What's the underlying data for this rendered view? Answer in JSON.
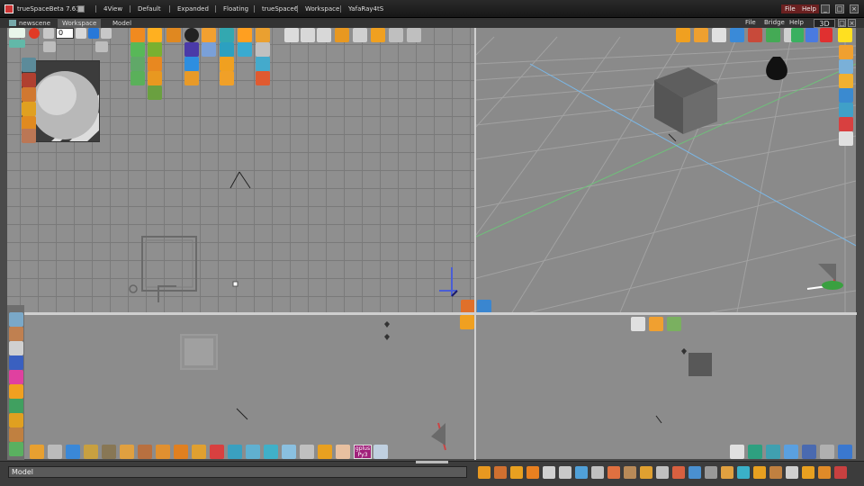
{
  "app": {
    "title": "trueSpaceBeta 7.61"
  },
  "contexts": [
    "4View",
    "Default",
    "Expanded",
    "Floating",
    "trueSpace6",
    "Workspace",
    "YafaRay4tS"
  ],
  "menus": {
    "file": "File",
    "help": "Help",
    "bridge": "Bridge",
    "view3d": "3D"
  },
  "window_controls": {
    "minimize": "_",
    "restore": "□",
    "close": "×"
  },
  "tabs": [
    "newscene",
    "Workspace",
    "Model"
  ],
  "active_tab": "Workspace",
  "timeline": {
    "frame": "0"
  },
  "status": {
    "text": "Model"
  },
  "badges": {
    "gplus": "gplus",
    "py": "Py3"
  },
  "colors": {
    "accent": "#1f5fbf",
    "grid_line": "#7a7a7a",
    "viewport_bg": "#8f8f8f",
    "divider": "#cfcfcf",
    "axis_x": "#ffffff",
    "axis_y": "#4a5ed6",
    "axis_z": "#e33030"
  }
}
